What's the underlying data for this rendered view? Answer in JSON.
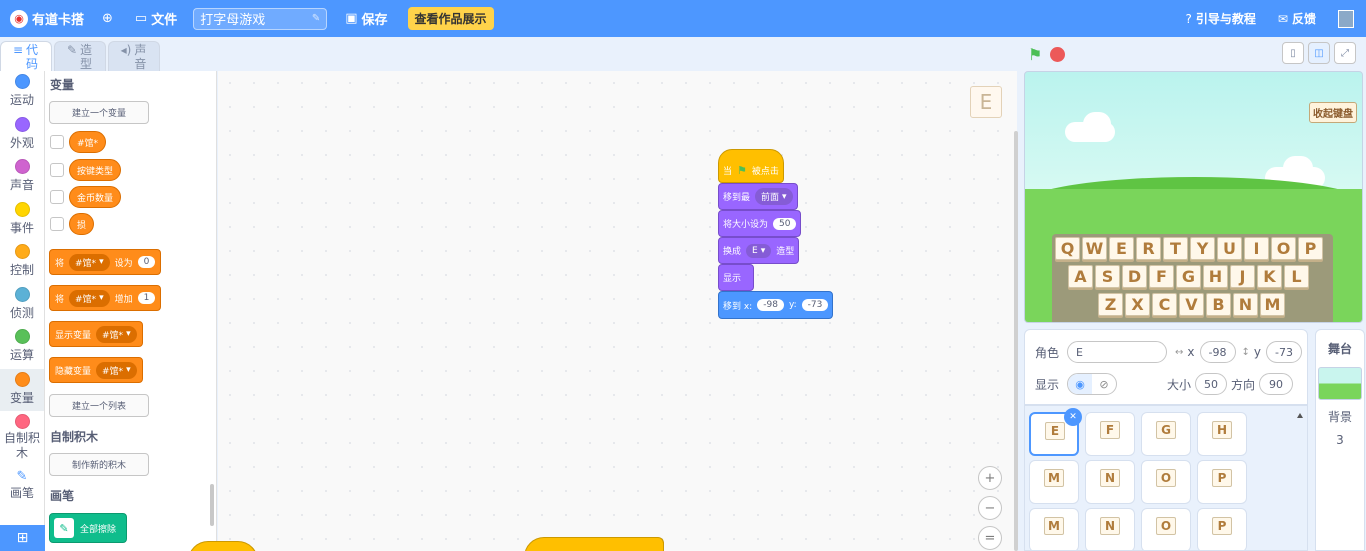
{
  "menu": {
    "logo_text": "有道卡搭",
    "file": "文件",
    "project_title": "打字母游戏",
    "save": "保存",
    "showcase": "查看作品展示",
    "guide": "引导与教程",
    "feedback": "反馈"
  },
  "tabs": [
    {
      "label": "代码",
      "icon": "code-icon"
    },
    {
      "label": "造型",
      "icon": "brush-icon"
    },
    {
      "label": "声音",
      "icon": "speaker-icon"
    }
  ],
  "categories": [
    {
      "label": "运动",
      "color": "#4c97ff"
    },
    {
      "label": "外观",
      "color": "#9966ff"
    },
    {
      "label": "声音",
      "color": "#cf63cf"
    },
    {
      "label": "事件",
      "color": "#ffd500"
    },
    {
      "label": "控制",
      "color": "#ffab19"
    },
    {
      "label": "侦测",
      "color": "#5cb1d6"
    },
    {
      "label": "运算",
      "color": "#59c059"
    },
    {
      "label": "变量",
      "color": "#ff8c1a"
    },
    {
      "label": "自制积木",
      "color": "#ff6680"
    },
    {
      "label": "画笔",
      "color": "#0fbd8c"
    }
  ],
  "palette": {
    "variables_heading": "变量",
    "make_variable": "建立一个变量",
    "variables": [
      "#馆*",
      "按键类型",
      "金币数量",
      "损"
    ],
    "set_block": {
      "prefix": "将",
      "var": "#馆*",
      "middle": "设为",
      "value": "0"
    },
    "change_block": {
      "prefix": "将",
      "var": "#馆*",
      "middle": "增加",
      "value": "1"
    },
    "show_var": {
      "label": "显示变量",
      "var": "#馆*"
    },
    "hide_var": {
      "label": "隐藏变量",
      "var": "#馆*"
    },
    "make_list": "建立一个列表",
    "my_blocks_heading": "自制积木",
    "make_block": "制作新的积木",
    "pen_heading": "画笔",
    "erase_all": "全部擦除"
  },
  "script": {
    "when_flag": {
      "pre": "当",
      "post": "被点击"
    },
    "go_to_layer": {
      "label": "移到最",
      "option": "前面"
    },
    "set_size": {
      "label": "将大小设为",
      "value": "50"
    },
    "switch_costume": {
      "label": "换成",
      "option": "E",
      "post": "造型"
    },
    "show": "显示",
    "go_to_xy": {
      "label": "移到 x:",
      "x": "-98",
      "ylabel": "y:",
      "y": "-73"
    }
  },
  "workspace_thumb": "E",
  "zoom": {
    "in": "+",
    "out": "−",
    "reset": "="
  },
  "stage": {
    "collapse_keyboard": "收起键盘",
    "keys_row1": [
      "Q",
      "W",
      "E",
      "R",
      "T",
      "Y",
      "U",
      "I",
      "O",
      "P"
    ],
    "keys_row2": [
      "A",
      "S",
      "D",
      "F",
      "G",
      "H",
      "J",
      "K",
      "L"
    ],
    "keys_row3": [
      "Z",
      "X",
      "C",
      "V",
      "B",
      "N",
      "M"
    ]
  },
  "sprite_info": {
    "sprite_label": "角色",
    "sprite_name": "E",
    "x_label": "x",
    "x_value": "-98",
    "y_label": "y",
    "y_value": "-73",
    "show_label": "显示",
    "size_label": "大小",
    "size_value": "50",
    "direction_label": "方向",
    "direction_value": "90"
  },
  "sprites": [
    {
      "key": "E",
      "row": 0,
      "col": 0,
      "selected": true
    },
    {
      "key": "F",
      "row": 0,
      "col": 1
    },
    {
      "key": "G",
      "row": 0,
      "col": 2
    },
    {
      "key": "H",
      "row": 0,
      "col": 3
    },
    {
      "key": "M",
      "row": 1,
      "col": 0
    },
    {
      "key": "N",
      "row": 1,
      "col": 1
    },
    {
      "key": "O",
      "row": 1,
      "col": 2
    },
    {
      "key": "P",
      "row": 1,
      "col": 3
    },
    {
      "key": "M",
      "row": 2,
      "col": 0
    },
    {
      "key": "N",
      "row": 2,
      "col": 1
    },
    {
      "key": "O",
      "row": 2,
      "col": 2
    },
    {
      "key": "P",
      "row": 2,
      "col": 3
    }
  ],
  "stage_panel": {
    "header": "舞台",
    "backdrop_label": "背景",
    "backdrop_count": "3"
  }
}
